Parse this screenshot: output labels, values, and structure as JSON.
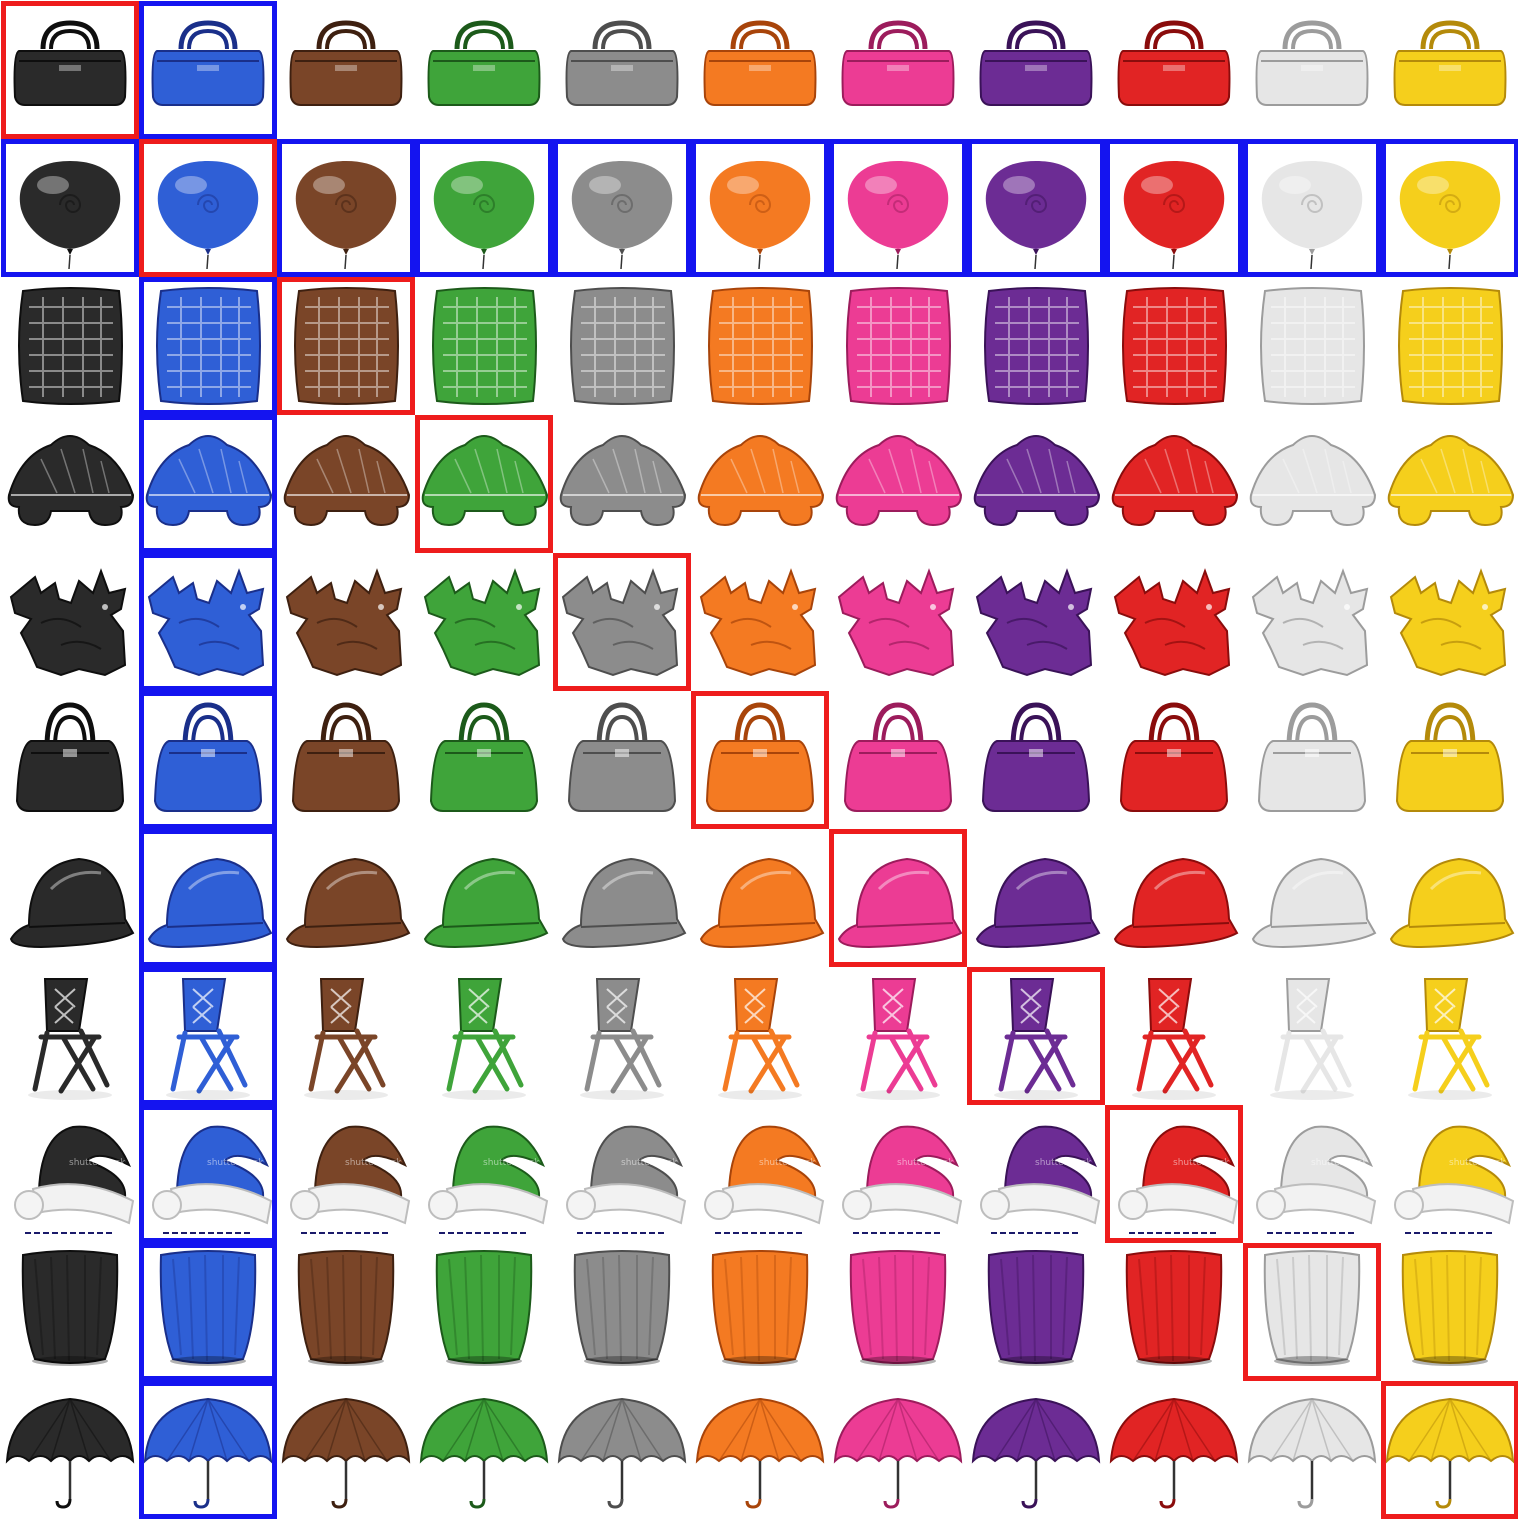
{
  "grid": {
    "rows": 11,
    "cols": 11,
    "objects": [
      "duffel-bag",
      "balloon",
      "pillow",
      "leaf-shape",
      "gargoyle",
      "handbag",
      "hard-hat",
      "folding-chair",
      "santa-hat",
      "vase",
      "umbrella"
    ],
    "colors": [
      {
        "name": "black",
        "hex": "#2a2a2a",
        "shade": "#0e0e0e"
      },
      {
        "name": "blue",
        "hex": "#2f5fd6",
        "shade": "#1a2f8a"
      },
      {
        "name": "brown",
        "hex": "#7a4528",
        "shade": "#3e2010"
      },
      {
        "name": "green",
        "hex": "#3fa43a",
        "shade": "#1c5a1a"
      },
      {
        "name": "gray",
        "hex": "#8c8c8c",
        "shade": "#4e4e4e"
      },
      {
        "name": "orange",
        "hex": "#f47a22",
        "shade": "#a8440a"
      },
      {
        "name": "pink",
        "hex": "#ec3c94",
        "shade": "#9c1c5c"
      },
      {
        "name": "purple",
        "hex": "#6c2c94",
        "shade": "#3a1258"
      },
      {
        "name": "red",
        "hex": "#e12424",
        "shade": "#8a0c0c"
      },
      {
        "name": "white",
        "hex": "#e6e6e6",
        "shade": "#9c9c9c"
      },
      {
        "name": "yellow",
        "hex": "#f5cf1c",
        "shade": "#b48a0a"
      }
    ],
    "highlight_colors": {
      "original": "#ee1c1c",
      "blue_column_row": "#1414f0"
    },
    "watermarks": {
      "santa_hat": "shutterstock"
    }
  }
}
